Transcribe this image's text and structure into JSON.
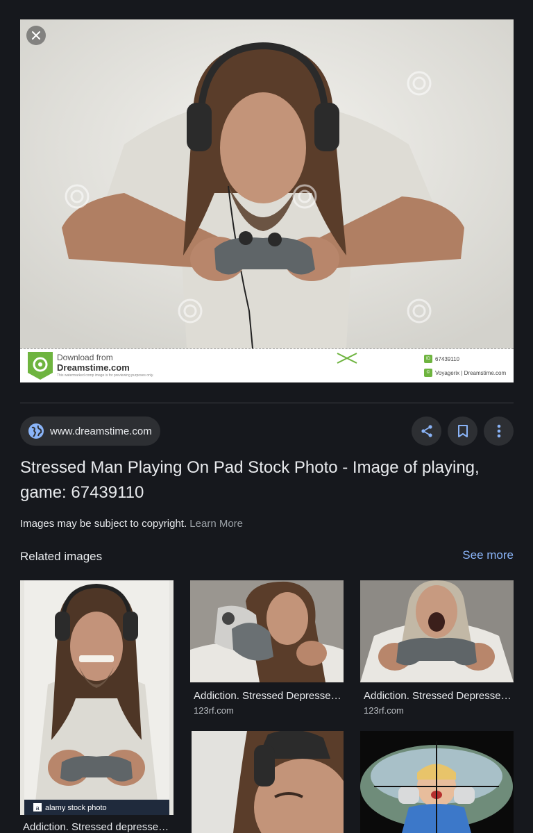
{
  "hero": {
    "banner": {
      "line1": "Download from",
      "line2": "Dreamstime.com",
      "line3": "This watermarked comp image is for previewing purposes only.",
      "id": "67439110",
      "credit": "Voyagerix | Dreamstime.com"
    }
  },
  "source": {
    "domain": "www.dreamstime.com"
  },
  "actions": [
    "share-icon",
    "bookmark-icon",
    "more-vert-icon"
  ],
  "title": "Stressed Man Playing On Pad Stock Photo - Image of playing, game: 67439110",
  "copyright": {
    "text": "Images may be subject to copyright.",
    "link": "Learn More"
  },
  "related": {
    "heading": "Related images",
    "see_more": "See more",
    "items": [
      {
        "title": "Addiction. Stressed depressed ...",
        "source": "",
        "watermark": "alamy stock photo"
      },
      {
        "title": "Addiction. Stressed Depressed...",
        "source": "123rf.com"
      },
      {
        "title": "Addiction. Stressed Depressed...",
        "source": "123rf.com"
      }
    ]
  },
  "colors": {
    "background": "#16181d",
    "accent": "#8ab4f8",
    "chip": "#2d2f33"
  }
}
